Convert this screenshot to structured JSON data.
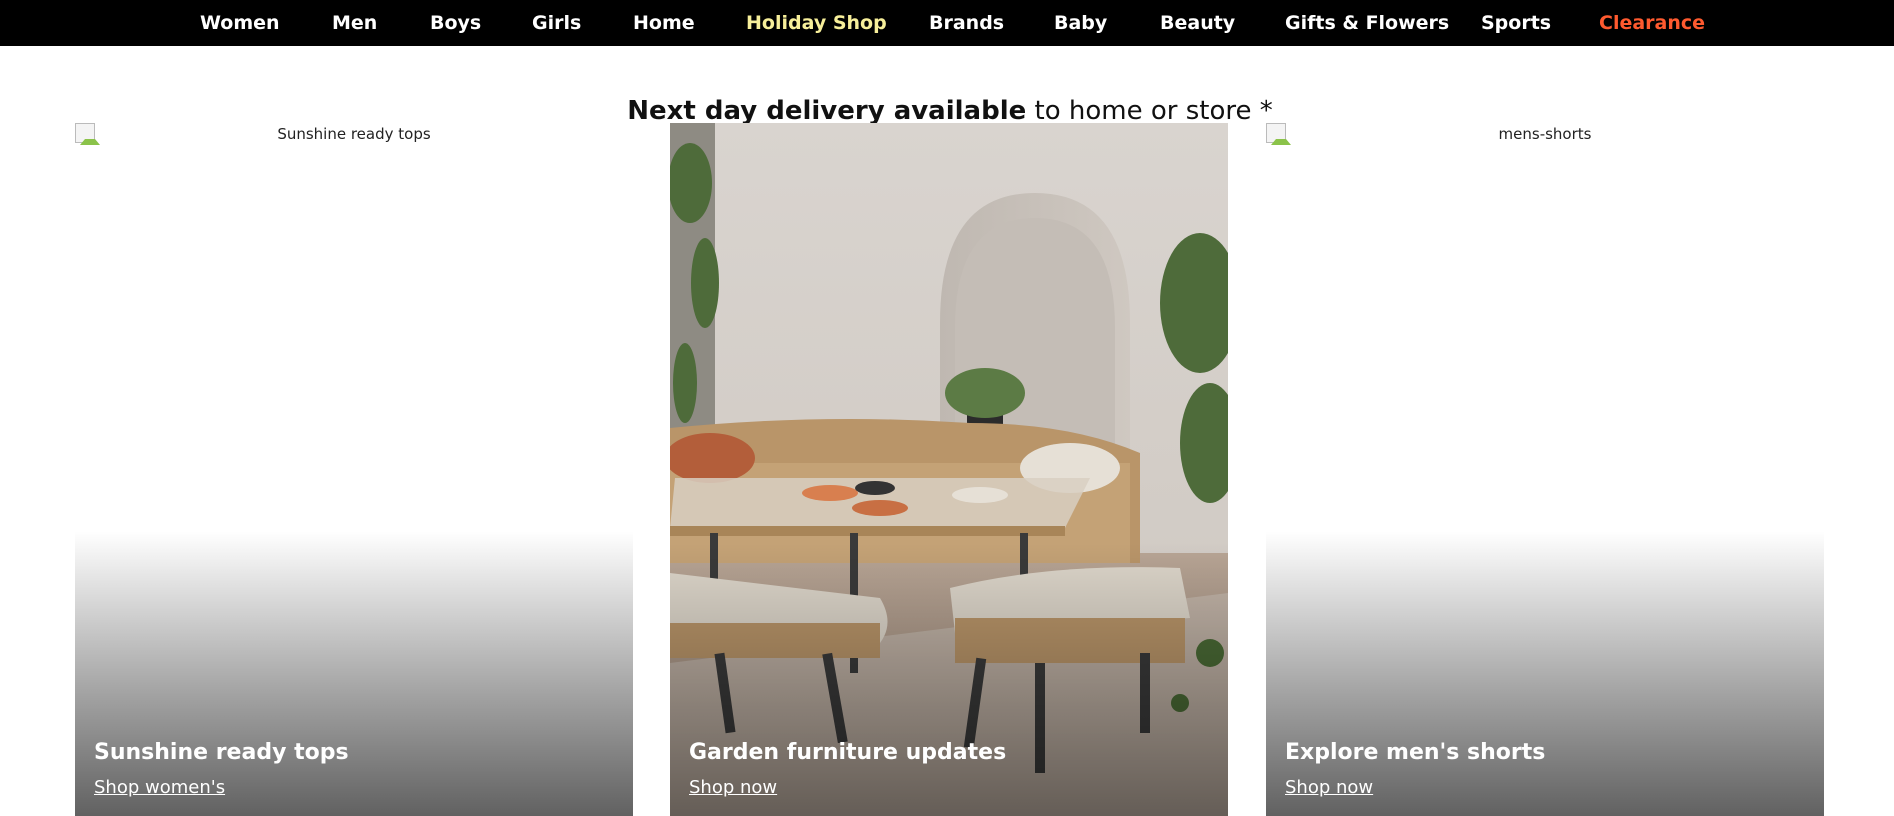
{
  "nav": {
    "items": [
      {
        "label": "Women"
      },
      {
        "label": "Men"
      },
      {
        "label": "Boys"
      },
      {
        "label": "Girls"
      },
      {
        "label": "Home"
      },
      {
        "label": "Holiday Shop",
        "color": "#f7ef9a"
      },
      {
        "label": "Brands"
      },
      {
        "label": "Baby"
      },
      {
        "label": "Beauty"
      },
      {
        "label": "Gifts & Flowers"
      },
      {
        "label": "Sports"
      },
      {
        "label": "Clearance",
        "color": "#ff5a2f"
      }
    ]
  },
  "banner": {
    "bold": "Next day delivery available",
    "rest": "to home or store *"
  },
  "cards": [
    {
      "image_alt": "Sunshine ready tops",
      "title": "Sunshine ready tops",
      "cta": "Shop women's",
      "image_state": "broken-image-icon"
    },
    {
      "title": "Garden furniture updates",
      "cta": "Shop now",
      "image_state": "garden-furniture-photo"
    },
    {
      "image_alt": "mens-shorts",
      "title": "Explore men's shorts",
      "cta": "Shop now",
      "image_state": "broken-image-icon"
    }
  ],
  "colors": {
    "nav_background": "#000000",
    "nav_text": "#ffffff",
    "holiday_shop": "#f7ef9a",
    "clearance": "#ff5a2f"
  }
}
